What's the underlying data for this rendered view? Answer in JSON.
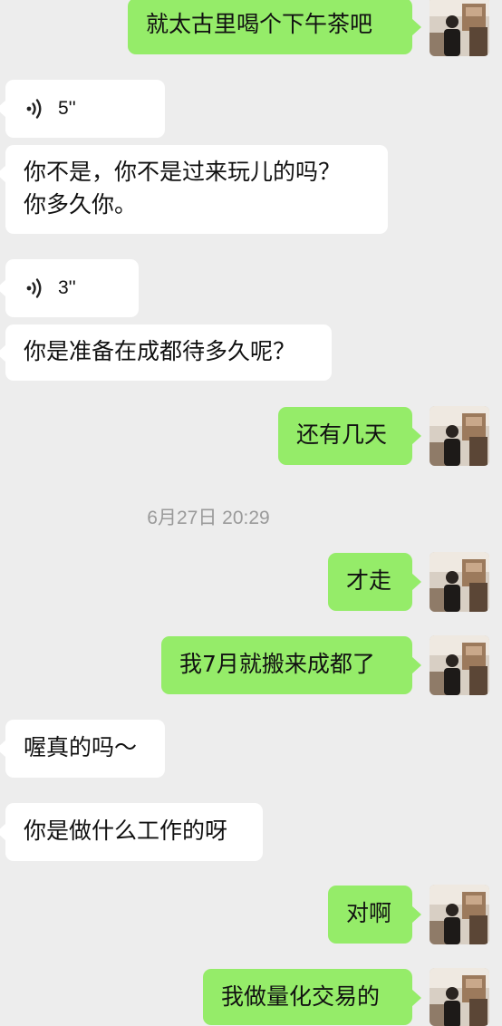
{
  "messages": [
    {
      "side": "out",
      "text": "就太古里喝个下午茶吧"
    },
    {
      "side": "in",
      "type": "voice",
      "duration": "5''"
    },
    {
      "side": "in",
      "line1": "你不是，你不是过来玩儿的吗？",
      "line2": "你多久你。"
    },
    {
      "side": "in",
      "type": "voice",
      "duration": "3''"
    },
    {
      "side": "in",
      "text": "你是准备在成都待多久呢？"
    },
    {
      "side": "out",
      "text": "还有几天"
    },
    {
      "side": "out",
      "text": "才走"
    },
    {
      "side": "out",
      "text": "我7月就搬来成都了"
    },
    {
      "side": "in",
      "text": "喔真的吗～"
    },
    {
      "side": "in",
      "text": "你是做什么工作的呀"
    },
    {
      "side": "out",
      "text": "对啊"
    },
    {
      "side": "out",
      "text": "我做量化交易的"
    }
  ],
  "timestamp": "6月27日 20:29",
  "icons": {
    "voice": "voice-wave-icon",
    "avatar": "user-avatar"
  },
  "colors": {
    "background": "#ededed",
    "outgoing_bubble": "#95ec69",
    "incoming_bubble": "#ffffff",
    "timestamp_text": "#9a9a9a"
  }
}
